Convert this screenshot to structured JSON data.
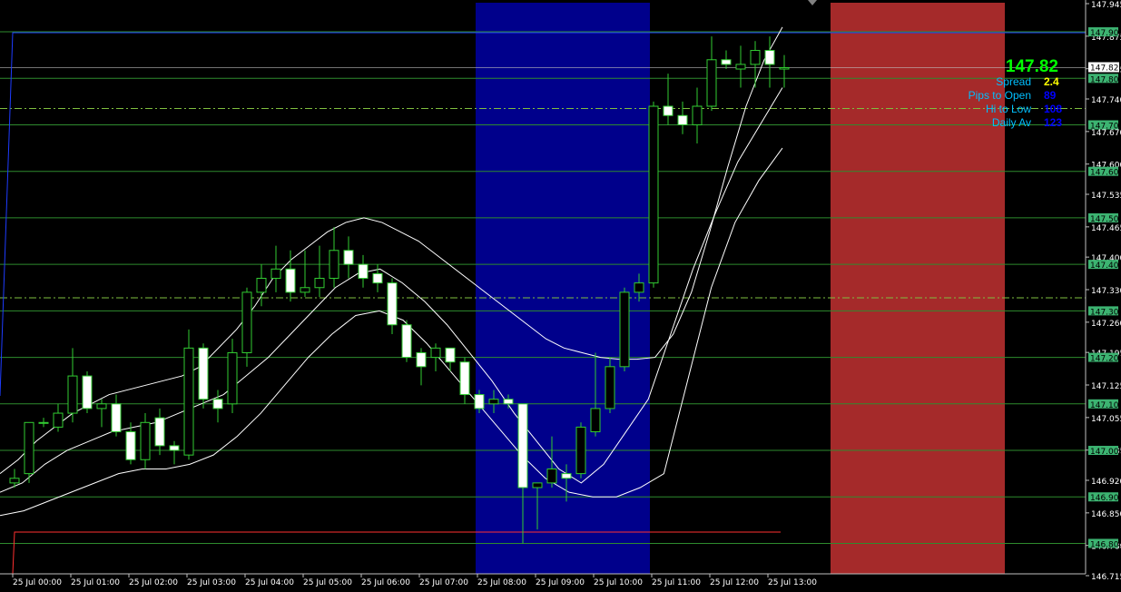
{
  "chart_data": {
    "type": "candlestick",
    "ylim": [
      146.715,
      147.945
    ],
    "y_ticks": [
      "147.945",
      "147.875",
      "147.805",
      "147.740",
      "147.670",
      "147.600",
      "147.535",
      "147.465",
      "147.400",
      "147.330",
      "147.260",
      "147.195",
      "147.125",
      "147.055",
      "146.985",
      "146.920",
      "146.850",
      "146.780",
      "146.715"
    ],
    "x_ticks": [
      "25 Jul 00:00",
      "25 Jul 01:00",
      "25 Jul 02:00",
      "25 Jul 03:00",
      "25 Jul 04:00",
      "25 Jul 05:00",
      "25 Jul 06:00",
      "25 Jul 07:00",
      "25 Jul 08:00",
      "25 Jul 09:00",
      "25 Jul 10:00",
      "25 Jul 11:00",
      "25 Jul 12:00",
      "25 Jul 13:00"
    ],
    "level_lines": [
      147.9,
      147.8,
      147.7,
      147.6,
      147.5,
      147.4,
      147.3,
      147.2,
      147.1,
      147.0,
      146.9,
      146.8
    ],
    "level_labels": [
      "147.900",
      "147.800",
      "147.700",
      "147.600",
      "147.500",
      "147.400",
      "147.300",
      "147.200",
      "147.100",
      "147.000",
      "146.900",
      "146.800"
    ],
    "current_price": 147.823,
    "current_price_label": "147.823",
    "dashdot_lines": [
      147.735,
      147.328
    ],
    "session_zones": [
      {
        "from": "25 Jul 08:00",
        "to": "25 Jul 11:00",
        "color": "#00008b"
      },
      {
        "from": "25 Jul 14:00",
        "to": "25 Jul 17:00",
        "color": "#a52a2a"
      }
    ],
    "candles": [
      {
        "o": 146.93,
        "h": 146.96,
        "l": 146.92,
        "c": 146.94
      },
      {
        "o": 146.95,
        "h": 147.06,
        "l": 146.93,
        "c": 147.06
      },
      {
        "o": 147.06,
        "h": 147.07,
        "l": 147.05,
        "c": 147.06
      },
      {
        "o": 147.05,
        "h": 147.1,
        "l": 147.04,
        "c": 147.08
      },
      {
        "o": 147.08,
        "h": 147.22,
        "l": 147.06,
        "c": 147.16
      },
      {
        "o": 147.16,
        "h": 147.17,
        "l": 147.08,
        "c": 147.09
      },
      {
        "o": 147.09,
        "h": 147.11,
        "l": 147.05,
        "c": 147.1
      },
      {
        "o": 147.1,
        "h": 147.12,
        "l": 147.03,
        "c": 147.04
      },
      {
        "o": 147.04,
        "h": 147.06,
        "l": 146.97,
        "c": 146.98
      },
      {
        "o": 146.98,
        "h": 147.08,
        "l": 146.96,
        "c": 147.06
      },
      {
        "o": 147.07,
        "h": 147.09,
        "l": 146.99,
        "c": 147.01
      },
      {
        "o": 147.01,
        "h": 147.02,
        "l": 146.97,
        "c": 147.0
      },
      {
        "o": 146.99,
        "h": 147.26,
        "l": 146.98,
        "c": 147.22
      },
      {
        "o": 147.22,
        "h": 147.23,
        "l": 147.09,
        "c": 147.11
      },
      {
        "o": 147.11,
        "h": 147.13,
        "l": 147.06,
        "c": 147.09
      },
      {
        "o": 147.1,
        "h": 147.24,
        "l": 147.08,
        "c": 147.21
      },
      {
        "o": 147.21,
        "h": 147.35,
        "l": 147.18,
        "c": 147.34
      },
      {
        "o": 147.34,
        "h": 147.4,
        "l": 147.31,
        "c": 147.37
      },
      {
        "o": 147.37,
        "h": 147.44,
        "l": 147.34,
        "c": 147.39
      },
      {
        "o": 147.39,
        "h": 147.43,
        "l": 147.32,
        "c": 147.34
      },
      {
        "o": 147.34,
        "h": 147.43,
        "l": 147.33,
        "c": 147.35
      },
      {
        "o": 147.35,
        "h": 147.44,
        "l": 147.33,
        "c": 147.37
      },
      {
        "o": 147.37,
        "h": 147.48,
        "l": 147.35,
        "c": 147.43
      },
      {
        "o": 147.43,
        "h": 147.46,
        "l": 147.37,
        "c": 147.4
      },
      {
        "o": 147.4,
        "h": 147.42,
        "l": 147.35,
        "c": 147.37
      },
      {
        "o": 147.38,
        "h": 147.4,
        "l": 147.34,
        "c": 147.36
      },
      {
        "o": 147.36,
        "h": 147.37,
        "l": 147.25,
        "c": 147.27
      },
      {
        "o": 147.27,
        "h": 147.28,
        "l": 147.19,
        "c": 147.2
      },
      {
        "o": 147.21,
        "h": 147.22,
        "l": 147.14,
        "c": 147.18
      },
      {
        "o": 147.2,
        "h": 147.23,
        "l": 147.17,
        "c": 147.22
      },
      {
        "o": 147.22,
        "h": 147.22,
        "l": 147.17,
        "c": 147.19
      },
      {
        "o": 147.19,
        "h": 147.2,
        "l": 147.1,
        "c": 147.12
      },
      {
        "o": 147.12,
        "h": 147.13,
        "l": 147.08,
        "c": 147.09
      },
      {
        "o": 147.1,
        "h": 147.13,
        "l": 147.08,
        "c": 147.11
      },
      {
        "o": 147.11,
        "h": 147.12,
        "l": 147.09,
        "c": 147.1
      },
      {
        "o": 147.1,
        "h": 147.1,
        "l": 146.8,
        "c": 146.92
      },
      {
        "o": 146.92,
        "h": 146.93,
        "l": 146.83,
        "c": 146.93
      },
      {
        "o": 146.93,
        "h": 147.03,
        "l": 146.92,
        "c": 146.96
      },
      {
        "o": 146.95,
        "h": 146.97,
        "l": 146.89,
        "c": 146.94
      },
      {
        "o": 146.95,
        "h": 147.06,
        "l": 146.94,
        "c": 147.05
      },
      {
        "o": 147.04,
        "h": 147.21,
        "l": 147.03,
        "c": 147.09
      },
      {
        "o": 147.09,
        "h": 147.2,
        "l": 147.08,
        "c": 147.18
      },
      {
        "o": 147.18,
        "h": 147.35,
        "l": 147.17,
        "c": 147.34
      },
      {
        "o": 147.34,
        "h": 147.38,
        "l": 147.32,
        "c": 147.36
      },
      {
        "o": 147.36,
        "h": 147.75,
        "l": 147.35,
        "c": 147.74
      },
      {
        "o": 147.74,
        "h": 147.81,
        "l": 147.7,
        "c": 147.72
      },
      {
        "o": 147.72,
        "h": 147.75,
        "l": 147.68,
        "c": 147.7
      },
      {
        "o": 147.7,
        "h": 147.78,
        "l": 147.66,
        "c": 147.74
      },
      {
        "o": 147.74,
        "h": 147.89,
        "l": 147.73,
        "c": 147.84
      },
      {
        "o": 147.84,
        "h": 147.86,
        "l": 147.82,
        "c": 147.83
      },
      {
        "o": 147.82,
        "h": 147.87,
        "l": 147.78,
        "c": 147.83
      },
      {
        "o": 147.83,
        "h": 147.88,
        "l": 147.78,
        "c": 147.86
      },
      {
        "o": 147.86,
        "h": 147.89,
        "l": 147.78,
        "c": 147.83
      },
      {
        "o": 147.82,
        "h": 147.85,
        "l": 147.78,
        "c": 147.823
      }
    ],
    "band_upper": [
      146.95,
      146.98,
      147.02,
      147.05,
      147.08,
      147.1,
      147.12,
      147.13,
      147.14,
      147.15,
      147.16,
      147.18,
      147.22,
      147.26,
      147.31,
      147.37,
      147.41,
      147.44,
      147.47,
      147.49,
      147.5,
      147.49,
      147.47,
      147.45,
      147.42,
      147.39,
      147.36,
      147.33,
      147.3,
      147.27,
      147.24,
      147.22,
      147.21,
      147.2,
      147.196,
      147.196,
      147.2,
      147.25,
      147.34,
      147.47,
      147.61,
      147.74,
      147.84,
      147.91
    ],
    "band_mid": [
      146.91,
      146.93,
      146.97,
      147.0,
      147.02,
      147.04,
      147.05,
      147.06,
      147.08,
      147.1,
      147.12,
      147.16,
      147.2,
      147.25,
      147.3,
      147.35,
      147.38,
      147.39,
      147.36,
      147.32,
      147.27,
      147.21,
      147.15,
      147.08,
      147.02,
      146.96,
      146.93,
      146.97,
      147.04,
      147.11,
      147.25,
      147.39,
      147.51,
      147.62,
      147.7,
      147.78
    ],
    "band_lower": [
      146.86,
      146.87,
      146.89,
      146.91,
      146.93,
      146.95,
      146.96,
      146.96,
      146.97,
      146.99,
      147.03,
      147.08,
      147.14,
      147.2,
      147.25,
      147.29,
      147.3,
      147.28,
      147.23,
      147.17,
      147.11,
      147.05,
      146.99,
      146.94,
      146.91,
      146.9,
      146.9,
      146.92,
      146.95,
      147.15,
      147.35,
      147.49,
      147.58,
      147.65
    ]
  },
  "info": {
    "big_price": "147.82",
    "spread_label": "Spread",
    "spread_value": "2.4",
    "pips_label": "Pips to Open",
    "pips_value": "89",
    "hilo_label": "Hi to Low",
    "hilo_value": "108",
    "daily_label": "Daily Av",
    "daily_value": "123"
  },
  "colors": {
    "background": "#000000",
    "level_line": "#2e8b2e",
    "label_bg": "#3cb371",
    "bull_body": "#000000",
    "bear_body": "#ffffff",
    "wick": "#32cd32",
    "band": "#ffffff",
    "big_price": "#00ff00",
    "info_label": "#00bfff",
    "spread_value": "#ffff00",
    "info_value": "#0000ff"
  }
}
